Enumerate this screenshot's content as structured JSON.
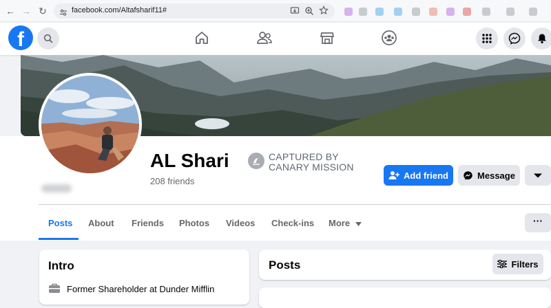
{
  "browser": {
    "url": "facebook.com/Altafsharif11#",
    "icons": [
      "back-arrow-icon",
      "forward-arrow-icon",
      "reload-icon",
      "site-info-icon",
      "install-icon",
      "zoom-icon",
      "bookmark-star-icon"
    ]
  },
  "header": {
    "logo": "f",
    "nav_icons": [
      "home-icon",
      "friends-icon",
      "marketplace-icon",
      "groups-icon"
    ],
    "right_icons": [
      "menu-grid-icon",
      "messenger-icon",
      "notifications-bell-icon"
    ]
  },
  "profile": {
    "name": "AL Shari",
    "friends": "208 friends",
    "badge_line1": "CAPTURED BY",
    "badge_line2": "CANARY MISSION",
    "add_friend_label": "Add friend",
    "message_label": "Message"
  },
  "tabs": [
    {
      "label": "Posts",
      "active": true
    },
    {
      "label": "About"
    },
    {
      "label": "Friends"
    },
    {
      "label": "Photos"
    },
    {
      "label": "Videos"
    },
    {
      "label": "Check-ins"
    },
    {
      "label": "More"
    }
  ],
  "more_dots": "···",
  "intro": {
    "title": "Intro",
    "work": "Former Shareholder at Dunder Mifflin"
  },
  "posts": {
    "title": "Posts",
    "filters_label": "Filters"
  },
  "colors": {
    "brand": "#1877f2",
    "page_bg": "#f0f2f5",
    "button_grey": "#e4e6eb"
  }
}
